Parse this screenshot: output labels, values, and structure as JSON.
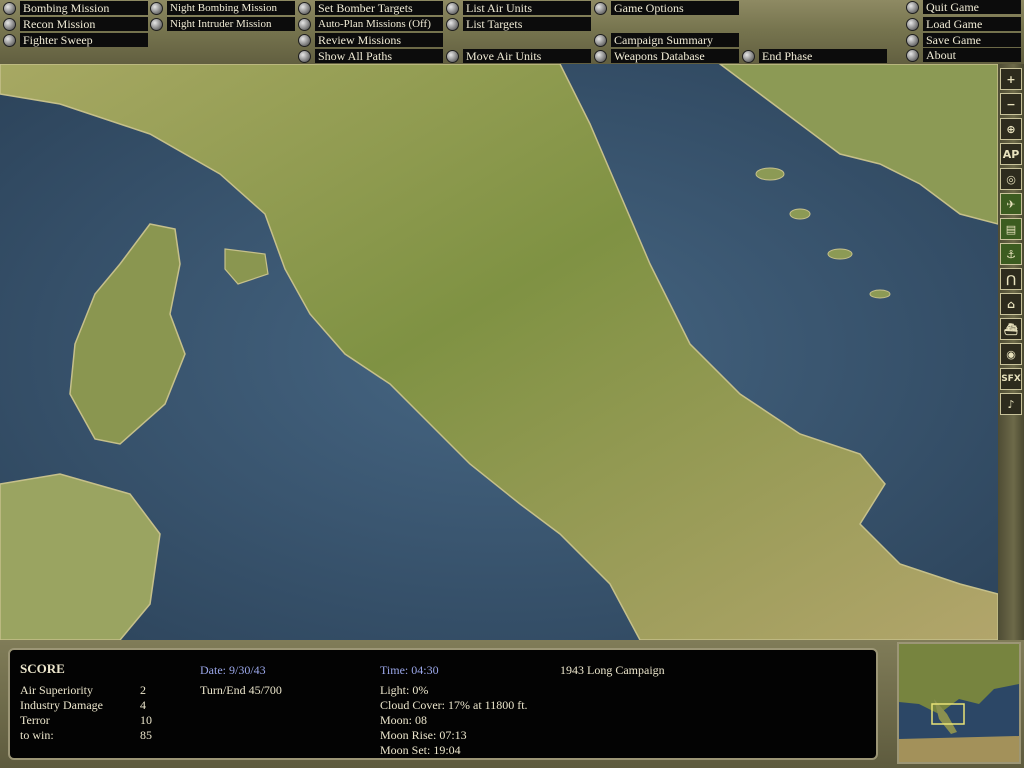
{
  "menu": {
    "col1": [
      "Bombing Mission",
      "Recon Mission",
      "Fighter Sweep"
    ],
    "col2": [
      "Night Bombing Mission",
      "Night Intruder Mission"
    ],
    "col3": [
      "Set Bomber Targets",
      "Auto-Plan Missions (Off)",
      "Review Missions",
      "Show All Paths"
    ],
    "col4": [
      "List Air Units",
      "List Targets",
      "Move Air Units"
    ],
    "col5": [
      "Game Options",
      "Campaign Summary",
      "Weapons Database"
    ],
    "col6": [
      "End Phase"
    ],
    "col7": [
      "Quit Game",
      "Load Game",
      "Save Game",
      "About"
    ]
  },
  "toolbar": {
    "icons": [
      "zoom-in-icon",
      "zoom-out-icon",
      "target-icon",
      "ap-icon",
      "compass-icon",
      "aircraft-icon",
      "factory-icon",
      "anchor-icon",
      "bridge-icon",
      "building-icon",
      "ship-icon",
      "radar-icon",
      "sfx-icon",
      "music-icon"
    ],
    "labels": [
      "+",
      "−",
      "⊕",
      "AP",
      "◎",
      "✈",
      "▤",
      "⚓",
      "⋂",
      "⌂",
      "⛴",
      "◉",
      "SFX",
      "♪"
    ]
  },
  "score": {
    "title": "SCORE",
    "rows": [
      {
        "label": "Air Superiority",
        "value": "2"
      },
      {
        "label": "Industry Damage",
        "value": "4"
      },
      {
        "label": "Terror",
        "value": "10"
      },
      {
        "label": "to win:",
        "value": "85"
      }
    ],
    "date": "Date: 9/30/43",
    "turn": "Turn/End  45/700",
    "time": "Time: 04:30",
    "campaign": "1943 Long Campaign",
    "conditions": [
      "Light: 0%",
      "Cloud Cover: 17% at 11800 ft.",
      "Moon: 08",
      "Moon Rise: 07:13",
      "Moon Set: 19:04"
    ]
  },
  "colors": {
    "sea": "#3e5a73",
    "land": "#8f9a4e",
    "allied": "#d8d8a0",
    "axis": "#c0181a"
  }
}
